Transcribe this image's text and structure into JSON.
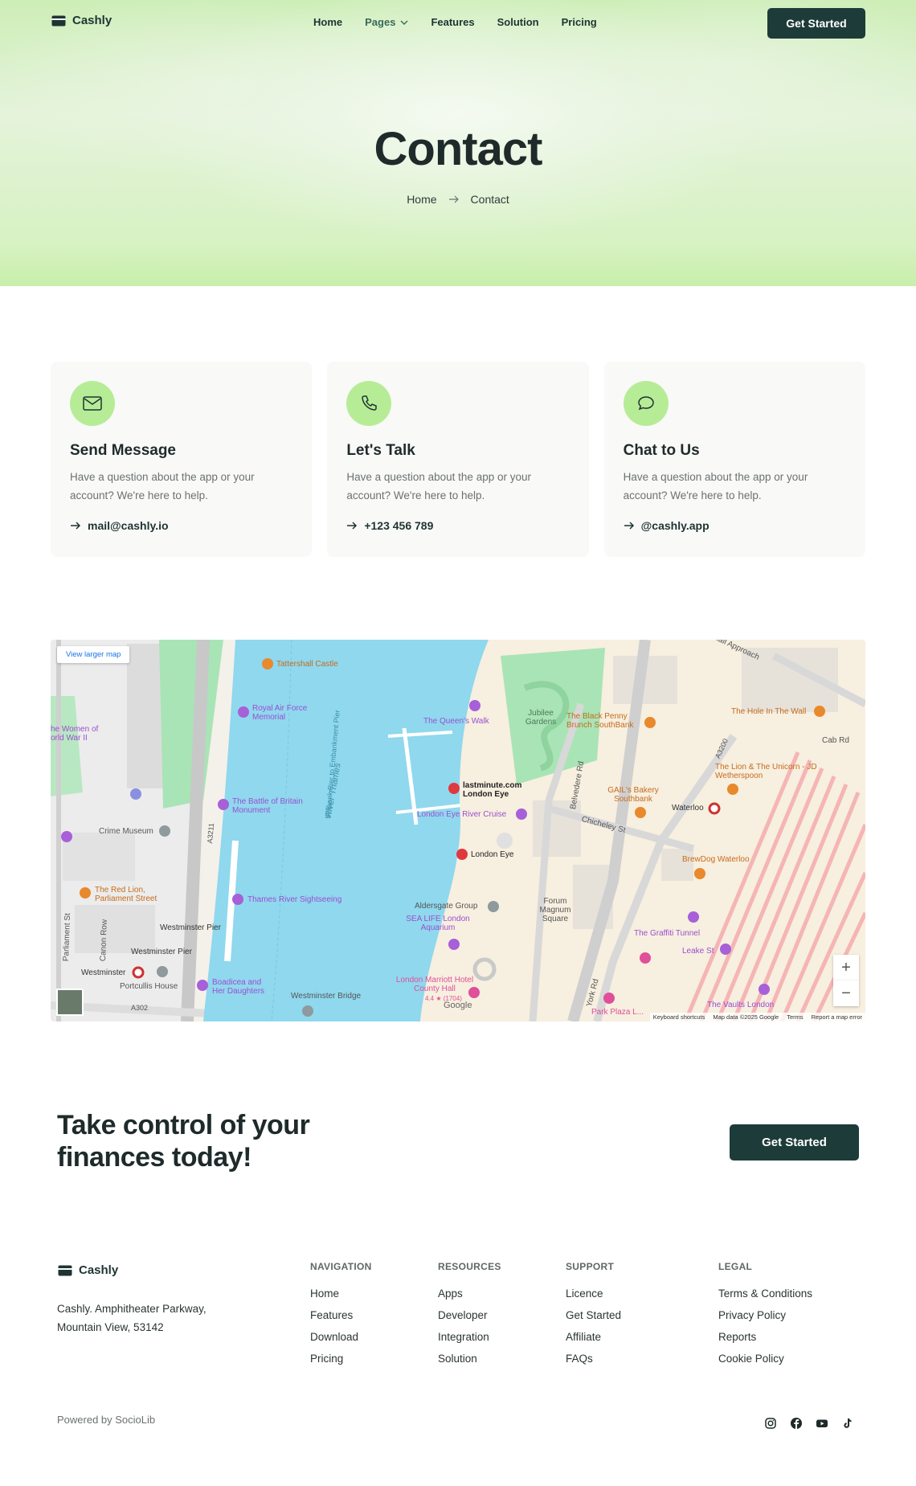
{
  "nav": {
    "brand": "Cashly",
    "links": [
      "Home",
      "Pages",
      "Features",
      "Solution",
      "Pricing"
    ],
    "active": "Pages",
    "cta": "Get Started"
  },
  "hero": {
    "title": "Contact",
    "breadcrumb": [
      "Home",
      "Contact"
    ]
  },
  "contact_cards": [
    {
      "icon": "mail-icon",
      "title": "Send Message",
      "text": "Have a question about the app or your account? We're here to help.",
      "link": "mail@cashly.io"
    },
    {
      "icon": "phone-icon",
      "title": "Let's Talk",
      "text": "Have a question about the app or your account? We're here to help.",
      "link": "+123 456 789"
    },
    {
      "icon": "chat-icon",
      "title": "Chat to Us",
      "text": "Have a question about the app or your account? We're here to help.",
      "link": "@cashly.app"
    }
  ],
  "map": {
    "view_larger": "View larger map",
    "labels": {
      "tattershall": "Tattershall Castle",
      "raf": "Royal Air Force Memorial",
      "battle": "The Battle of Britain Monument",
      "queens_walk": "The Queen's Walk",
      "jubilee": "Jubilee Gardens",
      "black_penny": "The Black Penny Brunch SouthBank",
      "lastminute": "lastminute.com London Eye",
      "river_cruise": "London Eye River Cruise",
      "london_eye": "London Eye",
      "gails": "GAIL's Bakery Southbank",
      "waterloo": "Waterloo",
      "hole_in_wall": "The Hole In The Wall",
      "lion_unicorn": "The Lion & The Unicorn - JD Wetherspoon",
      "brewdog": "BrewDog Waterloo",
      "crime_museum": "Crime Museum",
      "red_lion": "The Red Lion, Parliament Street",
      "thames_sightseeing": "Thames River Sightseeing",
      "westminster_pier": "Westminster Pier",
      "westminster": "Westminster",
      "portcullis": "Portcullis House",
      "boadicea": "Boadicea and Her Daughters",
      "westminster_bridge": "Westminster Bridge",
      "aldersgate": "Aldersgate Group",
      "sea_life": "SEA LIFE London Aquarium",
      "forum": "Forum Magnum Square",
      "marriott": "London Marriott Hotel County Hall",
      "marriott_rating": "4.4 ★ (1704)",
      "graffiti": "The Graffiti Tunnel",
      "leake": "Leake St",
      "vaults": "The Vaults London",
      "park_plaza": "Park Plaza L...",
      "river": "River Thames",
      "millbank": "Millbank Pier to Embankment Pier",
      "women_ww2": "he Women of orld War II",
      "chicheley": "Chicheley St",
      "belvedere": "Belvedere Rd",
      "york": "York Rd",
      "cab_rd": "Cab Rd",
      "a3200": "A3200",
      "a3211": "A3211",
      "a302": "A302",
      "parliament_st": "Parliament St",
      "canon_row": "Canon Row",
      "hall_approach": "Hall Approach",
      "google": "Google"
    },
    "attribution": [
      "Keyboard shortcuts",
      "Map data ©2025 Google",
      "Terms",
      "Report a map error"
    ]
  },
  "cta": {
    "headline": "Take control of your finances today!",
    "button": "Get Started"
  },
  "footer": {
    "brand": "Cashly",
    "address_line1": "Cashly. Amphitheater Parkway,",
    "address_line2": "Mountain View, 53142",
    "columns": [
      {
        "title": "NAVIGATION",
        "links": [
          "Home",
          "Features",
          "Download",
          "Pricing"
        ]
      },
      {
        "title": "RESOURCES",
        "links": [
          "Apps",
          "Developer",
          "Integration",
          "Solution"
        ]
      },
      {
        "title": "SUPPORT",
        "links": [
          "Licence",
          "Get Started",
          "Affiliate",
          "FAQs"
        ]
      },
      {
        "title": "LEGAL",
        "links": [
          "Terms & Conditions",
          "Privacy Policy",
          "Reports",
          "Cookie Policy"
        ]
      }
    ],
    "powered": "Powered by SocioLib",
    "social": [
      "instagram-icon",
      "facebook-icon",
      "youtube-icon",
      "tiktok-icon"
    ]
  },
  "colors": {
    "accent": "#b7ec97",
    "dark_button": "#1d3c39",
    "river": "#8fd8ee"
  }
}
